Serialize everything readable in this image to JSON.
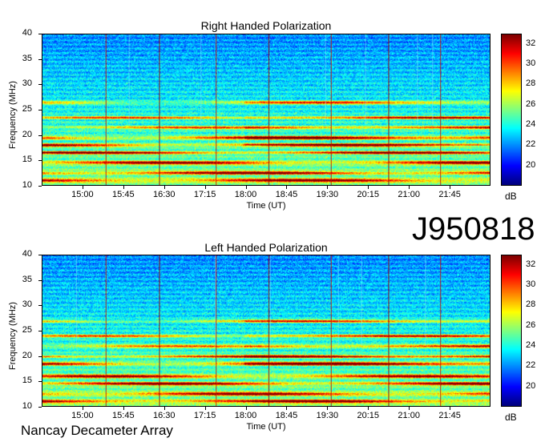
{
  "event_id": "J950818",
  "footer": "Nancay Decameter Array",
  "unit_label": "dB",
  "panels": [
    {
      "title": "Right Handed Polarization",
      "ylabel": "Frequency (MHz)",
      "xlabel": "Time (UT)"
    },
    {
      "title": "Left Handed Polarization",
      "ylabel": "Frequency (MHz)",
      "xlabel": "Time (UT)"
    }
  ],
  "x_ticks": [
    "15:00",
    "15:45",
    "16:30",
    "17:15",
    "18:00",
    "18:45",
    "19:30",
    "20:15",
    "21:00",
    "21:45"
  ],
  "y_ticks": [
    "10",
    "15",
    "20",
    "25",
    "30",
    "35",
    "40"
  ],
  "colorbar_ticks": [
    "20",
    "22",
    "24",
    "26",
    "28",
    "30",
    "32"
  ],
  "chart_data": [
    {
      "type": "heatmap",
      "title": "Right Handed Polarization",
      "xlabel": "Time (UT)",
      "ylabel": "Frequency (MHz)",
      "ylim": [
        10,
        40
      ],
      "x_range": [
        "14:15",
        "22:30"
      ],
      "colorbar": {
        "label": "dB",
        "range": [
          18,
          33
        ]
      },
      "features": {
        "strong_bands_MHz": [
          11,
          12.5,
          14.5,
          16.5,
          18,
          19.5,
          21.5,
          23.5,
          26.5
        ],
        "vertical_lines_UT": [
          "15:25",
          "16:24",
          "17:27",
          "18:25",
          "19:34",
          "20:38",
          "21:35"
        ]
      }
    },
    {
      "type": "heatmap",
      "title": "Left Handed Polarization",
      "xlabel": "Time (UT)",
      "ylabel": "Frequency (MHz)",
      "ylim": [
        10,
        40
      ],
      "x_range": [
        "14:15",
        "22:30"
      ],
      "colorbar": {
        "label": "dB",
        "range": [
          18,
          33
        ]
      },
      "features": {
        "strong_bands_MHz": [
          11,
          12.5,
          14.5,
          16,
          18.5,
          20,
          22,
          24,
          27
        ],
        "vertical_lines_UT": [
          "15:25",
          "16:24",
          "17:27",
          "18:25",
          "19:34",
          "20:38",
          "21:35"
        ]
      }
    }
  ]
}
